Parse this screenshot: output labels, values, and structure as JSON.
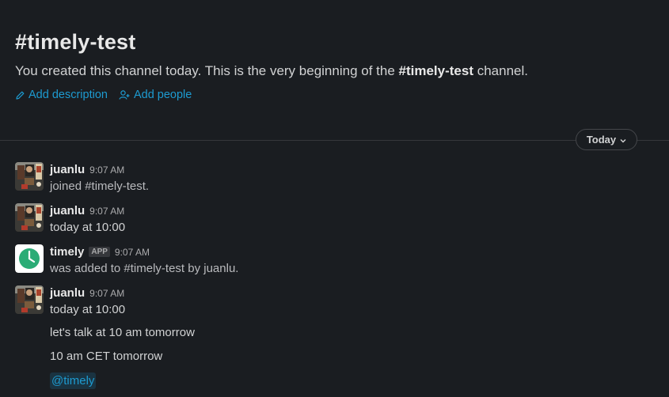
{
  "channel": {
    "title": "#timely-test",
    "intro_before": "You created this channel today. This is the very beginning of the ",
    "intro_channel": "#timely-test",
    "intro_after": " channel."
  },
  "actions": {
    "add_description": "Add description",
    "add_people": "Add people"
  },
  "divider": {
    "label": "Today"
  },
  "messages": [
    {
      "author": "juanlu",
      "time": "9:07 AM",
      "text": "joined #timely-test."
    },
    {
      "author": "juanlu",
      "time": "9:07 AM",
      "text": "today at 10:00"
    },
    {
      "author": "timely",
      "badge": "APP",
      "time": "9:07 AM",
      "text": "was added to #timely-test by juanlu."
    },
    {
      "author": "juanlu",
      "time": "9:07 AM",
      "text": "today at 10:00"
    }
  ],
  "followups": [
    "let's talk at 10 am tomorrow",
    "10 am CET tomorrow"
  ],
  "mention": "@timely",
  "colors": {
    "background": "#1a1d21",
    "link": "#1d9bd1",
    "timely_avatar": "#2bac76"
  }
}
